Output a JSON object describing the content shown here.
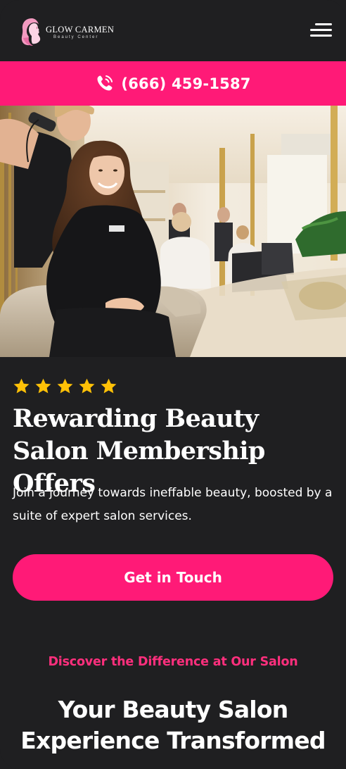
{
  "brand": {
    "name": "GLOW CARMEN",
    "tagline": "Beauty Center"
  },
  "header": {
    "menu_icon": "hamburger-menu-icon"
  },
  "contact": {
    "phone_icon": "phone-ringing-icon",
    "phone": "(666) 459-1587"
  },
  "hero": {
    "image": "Smiling woman in black dress seated in a salon chair while a stylist dries her long wavy hair in a bright gold-accented salon"
  },
  "rating": {
    "stars": 5,
    "icon": "star-icon",
    "color": "#ffc107"
  },
  "main": {
    "headline": "Rewarding Beauty Salon Membership Offers",
    "intro": "Join a journey towards ineffable beauty, boosted by a suite of expert salon services.",
    "cta_label": "Get in Touch"
  },
  "next_section": {
    "eyebrow": "Discover the Difference at Our Salon",
    "title": "Your Beauty Salon Experience Transformed"
  },
  "colors": {
    "accent": "#ff1a77",
    "background": "#1f1f21",
    "text": "#ffffff"
  }
}
